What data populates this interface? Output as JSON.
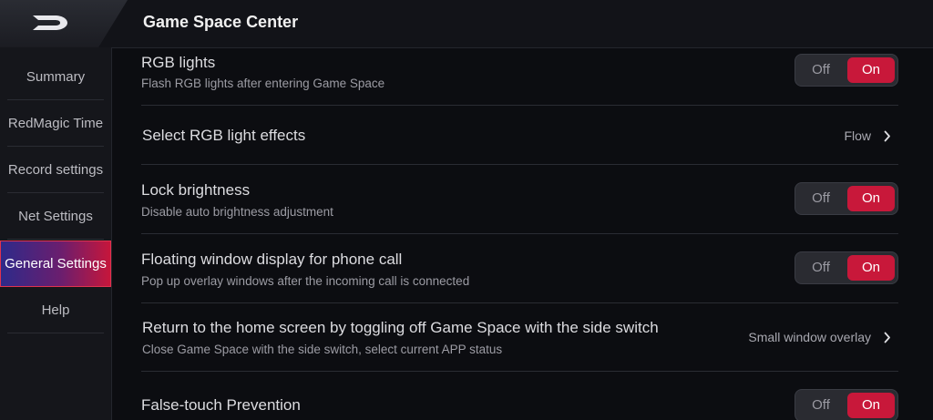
{
  "header": {
    "logo_icon": "redmagic-logo-icon",
    "title": "Game Space Center"
  },
  "sidebar": {
    "items": [
      {
        "label": "Summary",
        "active": false
      },
      {
        "label": "RedMagic Time",
        "active": false
      },
      {
        "label": "Record settings",
        "active": false
      },
      {
        "label": "Net Settings",
        "active": false
      },
      {
        "label": "General Settings",
        "active": true
      },
      {
        "label": "Help",
        "active": false
      }
    ]
  },
  "settings": {
    "rgb_lights": {
      "title": "RGB lights",
      "subtitle": "Flash RGB lights after entering Game Space",
      "off_label": "Off",
      "on_label": "On",
      "state": "On"
    },
    "rgb_effects": {
      "title": "Select RGB light effects",
      "value": "Flow",
      "icon": "chevron-right-icon"
    },
    "lock_brightness": {
      "title": "Lock brightness",
      "subtitle": "Disable auto brightness adjustment",
      "off_label": "Off",
      "on_label": "On",
      "state": "On"
    },
    "floating_window": {
      "title": "Floating window display for phone call",
      "subtitle": "Pop up overlay windows after the incoming call is connected",
      "off_label": "Off",
      "on_label": "On",
      "state": "On"
    },
    "return_home": {
      "title": "Return to the home screen by toggling off Game Space with the side switch",
      "subtitle": "Close Game Space with the side switch, select current APP status",
      "value": "Small window overlay",
      "icon": "chevron-right-icon"
    },
    "false_touch": {
      "title": "False-touch Prevention",
      "off_label": "Off",
      "on_label": "On",
      "state": "On"
    }
  },
  "colors": {
    "accent": "#c8183a",
    "background": "#0c0d11",
    "sidebar_active_gradient_start": "#2d2a8a",
    "sidebar_active_gradient_end": "#c8163a"
  }
}
